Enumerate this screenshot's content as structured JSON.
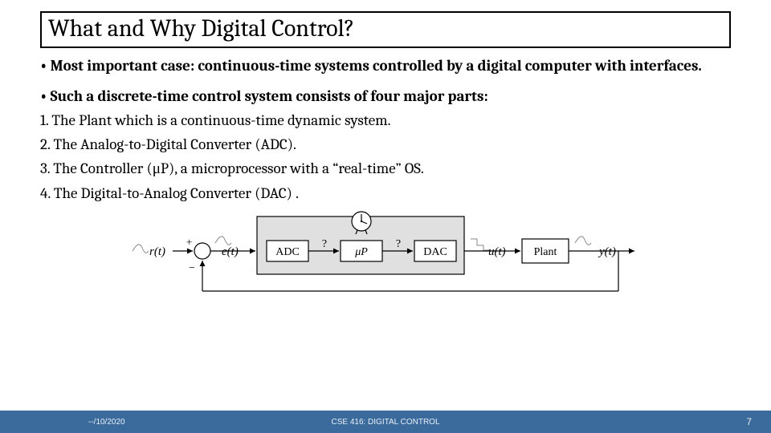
{
  "title": "What and Why Digital Control?",
  "bullets": [
    "Most important case: continuous-time systems controlled by a digital computer with interfaces.",
    "Such a discrete-time control system consists of four major parts:"
  ],
  "items": [
    "1. The Plant which is a continuous-time dynamic system.",
    "2. The Analog-to-Digital Converter (ADC).",
    "3. The Controller (μP), a microprocessor with a “real-time” OS.",
    "4. The Digital-to-Analog Converter (DAC) ."
  ],
  "diagram": {
    "labels": {
      "r": "r(t)",
      "plus": "+",
      "minus": "−",
      "e": "e(t)",
      "adc": "ADC",
      "q1": "?",
      "mup": "μP",
      "q2": "?",
      "dac": "DAC",
      "u": "u(t)",
      "plant": "Plant",
      "y": "y(t)"
    }
  },
  "footer": {
    "date": "--/10/2020",
    "course": "CSE 416: DIGITAL CONTROL",
    "page": "7"
  }
}
